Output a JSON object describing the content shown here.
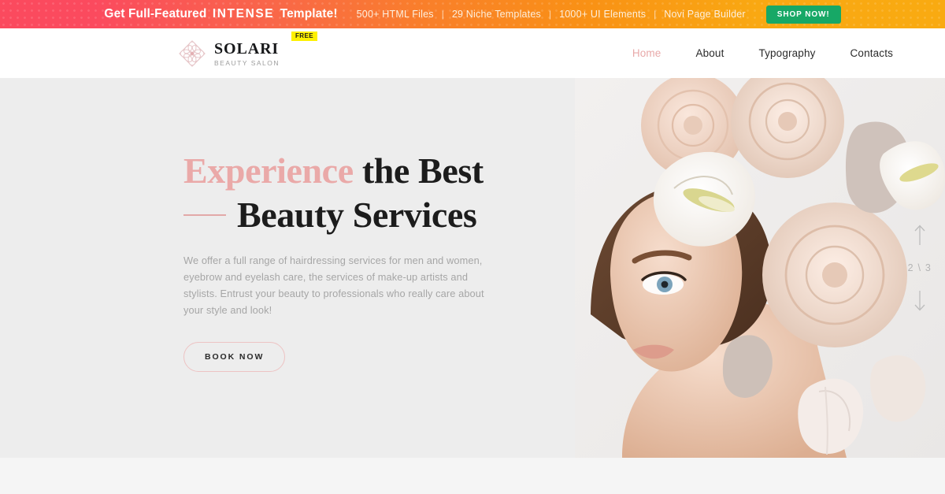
{
  "promo": {
    "title_prefix": "Get Full-Featured",
    "title_brand": "INTENSE",
    "title_suffix": "Template!",
    "features": [
      "500+ HTML Files",
      "29 Niche Templates",
      "1000+ UI Elements",
      "Novi Page Builder"
    ],
    "separator": "|",
    "cta_label": "SHOP NOW!",
    "gradient_start": "#fb4a5e",
    "gradient_end": "#f9a812",
    "cta_color": "#17a866"
  },
  "header": {
    "brand_name": "SOLARI",
    "brand_tagline": "BEAUTY SALON",
    "badge": "FREE",
    "badge_color": "#fdf000",
    "nav": [
      {
        "label": "Home",
        "active": true
      },
      {
        "label": "About",
        "active": false
      },
      {
        "label": "Typography",
        "active": false
      },
      {
        "label": "Contacts",
        "active": false
      }
    ],
    "active_color": "#e8a9a9"
  },
  "hero": {
    "heading_accent": "Experience",
    "heading_rest": "the Best",
    "heading_line2": "Beauty Services",
    "paragraph": "We offer a full range of hairdressing services for men and women, eyebrow and eyelash care, the services of make-up artists and stylists. Entrust your beauty to professionals who really care about your style and look!",
    "cta_label": "BOOK NOW",
    "accent_color": "#eaa9a8",
    "background": "#ededed",
    "slider": {
      "current": "2",
      "divider": "\\",
      "total": "3",
      "counter": "2 \\ 3",
      "up_label": "previous-slide",
      "down_label": "next-slide"
    }
  }
}
